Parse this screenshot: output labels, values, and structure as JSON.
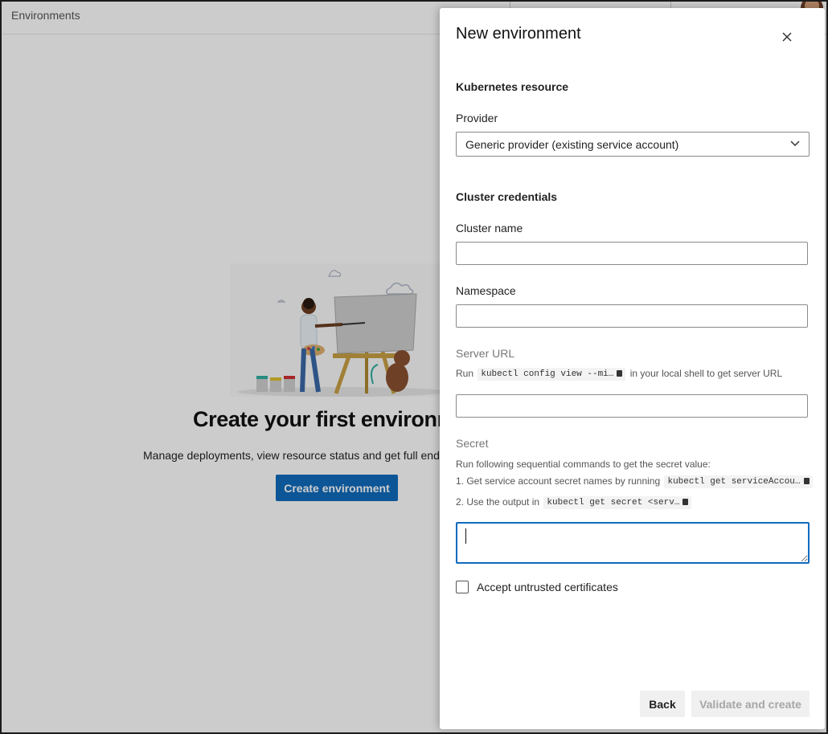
{
  "background": {
    "header_title": "Environments",
    "empty_title": "Create your first environm",
    "empty_desc": "Manage deployments, view resource status and get full end",
    "create_button": "Create environment"
  },
  "panel": {
    "title": "New environment",
    "section_resource": "Kubernetes resource",
    "provider_label": "Provider",
    "provider_value": "Generic provider (existing service account)",
    "section_credentials": "Cluster credentials",
    "cluster_name_label": "Cluster name",
    "cluster_name_value": "",
    "namespace_label": "Namespace",
    "namespace_value": "",
    "server_url_label": "Server URL",
    "server_url_hint_pre": "Run",
    "server_url_code": "kubectl config view --mi…",
    "server_url_hint_post": "in your local shell to get server URL",
    "server_url_value": "",
    "secret_label": "Secret",
    "secret_hint": "Run following sequential commands to get the secret value:",
    "secret_step1_pre": "1. Get service account secret names by running",
    "secret_step1_code": "kubectl get serviceAccou…",
    "secret_step2_pre": "2. Use the output in",
    "secret_step2_code": "kubectl get secret <serv…",
    "secret_value": "",
    "accept_label": "Accept untrusted certificates",
    "back_button": "Back",
    "validate_button": "Validate and create"
  },
  "icons": {
    "close": "close-icon",
    "dropdown": "chevron-down-icon",
    "copy": "copy-icon",
    "avatar": "avatar"
  },
  "colors": {
    "accent": "#0f6cbd",
    "overlay": "rgba(0,0,0,0.2)",
    "disabled_text": "#a6a6a6"
  }
}
